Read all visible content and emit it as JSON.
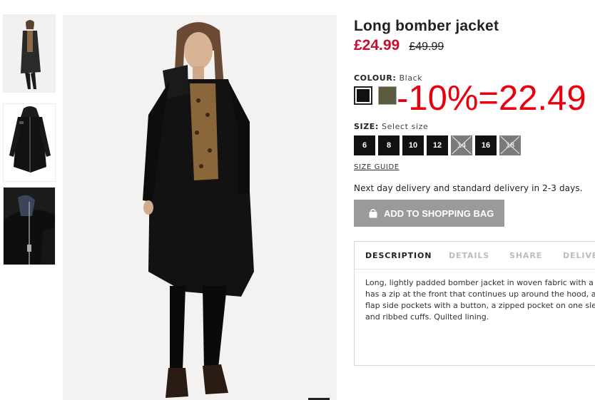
{
  "product": {
    "title": "Long bomber jacket",
    "price_now": "£24.99",
    "price_old": "£49.99"
  },
  "colour": {
    "label": "COLOUR:",
    "selected": "Black",
    "swatches": [
      {
        "name": "Black",
        "hex": "#111111"
      },
      {
        "name": "Khaki",
        "hex": "#5e5a3f"
      }
    ]
  },
  "annotation": "-10%=22.49",
  "size": {
    "label": "SIZE:",
    "prompt": "Select size",
    "options": [
      {
        "label": "6",
        "available": true
      },
      {
        "label": "8",
        "available": true
      },
      {
        "label": "10",
        "available": true
      },
      {
        "label": "12",
        "available": true
      },
      {
        "label": "14",
        "available": false
      },
      {
        "label": "16",
        "available": true
      },
      {
        "label": "18",
        "available": false
      }
    ],
    "guide_label": "SIZE GUIDE"
  },
  "delivery_text": "Next day delivery and standard delivery in 2-3 days.",
  "add_to_bag_label": "ADD TO SHOPPING BAG",
  "tabs": [
    {
      "label": "DESCRIPTION",
      "active": true
    },
    {
      "label": "DETAILS",
      "active": false
    },
    {
      "label": "SHARE",
      "active": false
    },
    {
      "label": "DELIVER",
      "active": false
    }
  ],
  "description_lines": [
    "Long, lightly padded bomber jacket in woven fabric with a line",
    "has a zip at the front that continues up around the hood, a zip",
    "flap side pockets with a button, a zipped pocket on one sleev",
    "and ribbed cuffs. Quilted lining."
  ],
  "colors": {
    "sale_red": "#c8102e",
    "annotation_red": "#e8000e",
    "button_grey": "#9a9a9a"
  }
}
